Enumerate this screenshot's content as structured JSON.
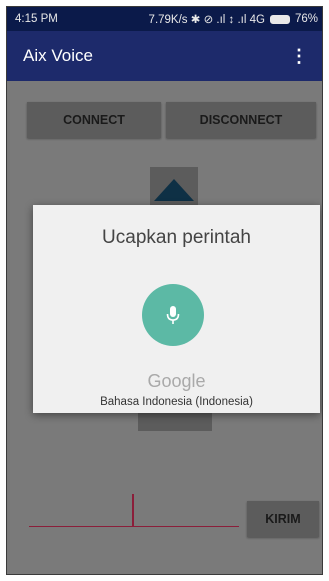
{
  "status_bar": {
    "time": "4:15 PM",
    "indicators": "7.79K/s ✱ ⊘ .ıl ↕ .ıl 4G",
    "battery": "76%"
  },
  "app_bar": {
    "title": "Aix Voice",
    "menu_icon": "overflow-menu-icon",
    "color": "#1d2a6b"
  },
  "controls": {
    "connect_label": "CONNECT",
    "disconnect_label": "DISCONNECT",
    "send_label": "KIRIM"
  },
  "voice_dialog": {
    "prompt": "Ucapkan perintah",
    "brand": "Google",
    "language": "Bahasa Indonesia (Indonesia)",
    "mic_icon": "microphone-icon",
    "mic_color": "#5cb9a5"
  }
}
